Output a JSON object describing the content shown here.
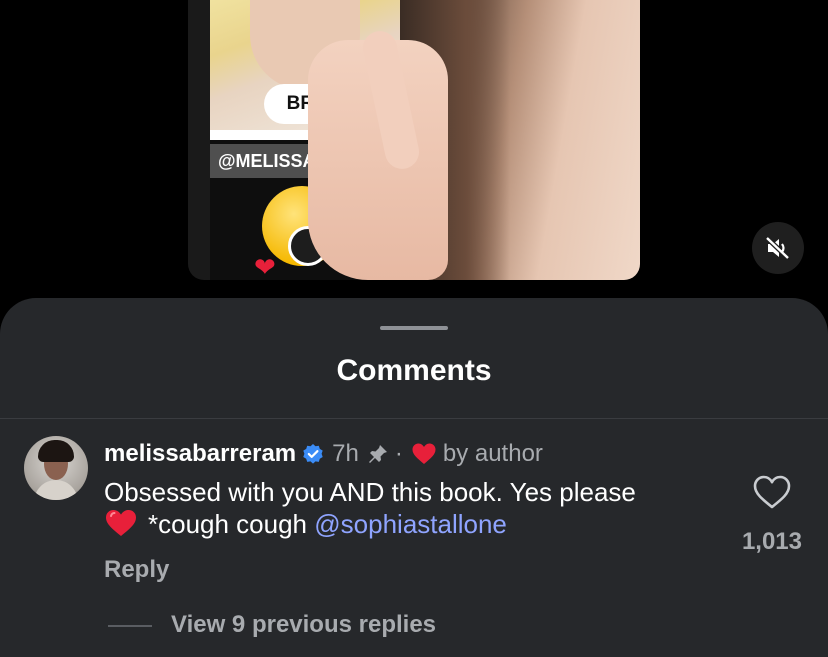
{
  "video": {
    "sticker_label": "BRI",
    "overlay_handle": "@MELISSABARRE",
    "mute_icon": "speaker-muted-icon"
  },
  "comments": {
    "title": "Comments",
    "items": [
      {
        "username": "melissabarreram",
        "verified": true,
        "time": "7h",
        "pinned": true,
        "separator": "·",
        "author_liked_text": "by author",
        "text": "Obsessed with you AND this book. Yes please",
        "text_line2": "*cough cough",
        "mention": "@sophiastallone",
        "reply_label": "Reply",
        "likes": "1,013",
        "view_replies": "View 9 previous replies"
      }
    ]
  },
  "colors": {
    "sheet_bg": "#26282b",
    "mention": "#8fa4ff",
    "verified": "#3b8cf6",
    "heart": "#e8203a",
    "muted_text": "#a8abaf"
  }
}
